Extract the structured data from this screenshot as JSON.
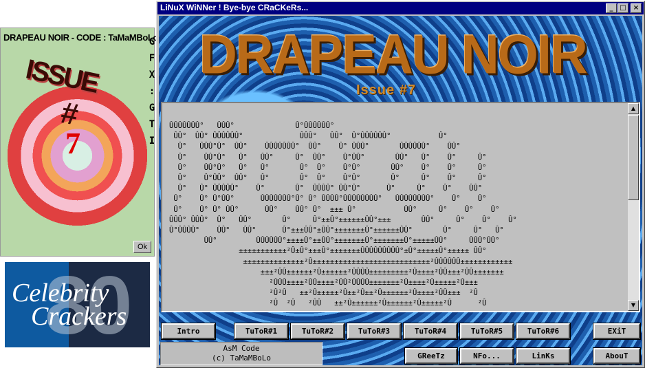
{
  "cover": {
    "title": "DRAPEAU NOIR - CODE : TaMaMBoLo",
    "side_text": "GFX:GTI",
    "issue_text": "ISSUE",
    "hash_text": "#",
    "number": "7",
    "ok_label": "Ok"
  },
  "logo": {
    "number": "80",
    "line1": "Celebrity",
    "line2": "Crackers"
  },
  "window": {
    "title": "LiNuX WiNNer ! Bye-bye CRaCKeRs...",
    "minimize": "_",
    "maximize": "□",
    "close": "×"
  },
  "banner": {
    "title": "DRAPEAU NOIR",
    "issue": "Issue #7"
  },
  "ascii_art": "ÛÛÛÛÛÛÛ°   ÛÛÛ°              Û°ÛÛÛÛÛÛ°\n ÛÛ°  ÛÛ° ÛÛÛÛÛÛ°             ÛÛÛ°   ÛÛ°  Û°ÛÛÛÛÛÛ°           Û°\n  Û°   ÛÛÛ°Û°  ÛÛ°    ÛÛÛÛÛÛÛ°  ÛÛ°    Û° ÛÛÛ°       ÛÛÛÛÛÛ°    ÛÛ°\n  Û°    ÛÛ°Û°   Û°   ÛÛ°     Û°  ÛÛ°    Û°ÛÛ°       ÛÛ°   Û°    Û°     Û°\n  Û°    ÛÛ°Û°   Û°   Û°       Û°  Û°    Û°Û°       ÛÛ°    Û°    Û°     Û°\n  Û°    Û°ÛÛ°  ÛÛ°   Û°       Û°  Û°    Û°Û°       Û°     Û°    Û°     Û°\n  Û°   Û° ÛÛÛÛÛ°    Û°       Û°  ÛÛÛÛ° ÛÛ°Û°      Û°     Û°    Û°    ÛÛ°\n Û°    Û° Û°ÛÛ°      ÛÛÛÛÛÛÛ°Û° Û° ÛÛÛÛ°ÛÛÛÛÛÛÛÛ°   ÛÛÛÛÛÛÛÛ°    Û°    Û°\n Û°    Û° Û° ÛÛ°      ÛÛ°    ÛÛ° Û°  ±±± Û°           ÛÛ°     Û°    Û°    Û°\nÛÛÛ° ÛÛÛ°  Û°   ÛÛ°       Û°     Û°±±Û°±±±±±±ÛÛ°±±±       ÛÛ°     Û°    Û°    Û°\nÛ°ÛÛÛÛ°    ÛÛ°   ÛÛ°      Û°±±±ÛÛ°±ÛÛ°±±±±±±±Û°±±±±±±ÛÛ°       Û°     Û°   Û°\n        ÛÛ°         ÛÛÛÛÛÛ°±±±±Û°±±ÛÛ°±±±±±±±Û°±±±±±±±Û°±±±±±ÛÛ°     ÛÛÛ°ÛÛ°\n                ±±±±±±±±±±±²Û±Û°±±±Û°±±±±±±±ÛÛÛÛÛÛÛÛÛ°±Û°±±±±±Û°±±±±± ÛÛ°\n                 ±±±±±±±±±±±±±±²Û±±±±±±±±±±±±±±±±±±±±±±±±±±±²ÛÛÛÛÛÛ±±±±±±±±±±±±\n                     ±±±²ÛÛ±±±±±±²Û±±±±±±²ÛÛÛÛ±±±±±±±±±²Û±±±±²ÛÛ±±±²ÛÛ±±±±±±±\n                       ²ÛÛÛ±±±±²ÛÛ±±±±²ÛÛ²ÛÛÛÛ±±±±±±±²Û±±±±²Û±±±±±²Û±±±\n                       ²Û²Û   ±±²Û±±±±±²Û±±²Û±±²Û±±±±±±²Û±±±±²ÛÛ±±±  ²Û\n                       ²Û  ²Û   ²ÛÛ   ±±²Û±±±±±±²Û±±±±±±²Û±±±±±²Û      ²Û",
  "nav_buttons": [
    "Intro",
    "TuToR#1",
    "TuToR#2",
    "TuToR#3",
    "TuToR#4",
    "TuToR#5",
    "TuToR#6",
    "EXiT"
  ],
  "bottom_buttons": [
    "GReeTz",
    "NFo...",
    "LinKs",
    "AbouT"
  ],
  "credits": {
    "line1": "AsM Code",
    "line2": "(c) TaMaMBoLo"
  }
}
